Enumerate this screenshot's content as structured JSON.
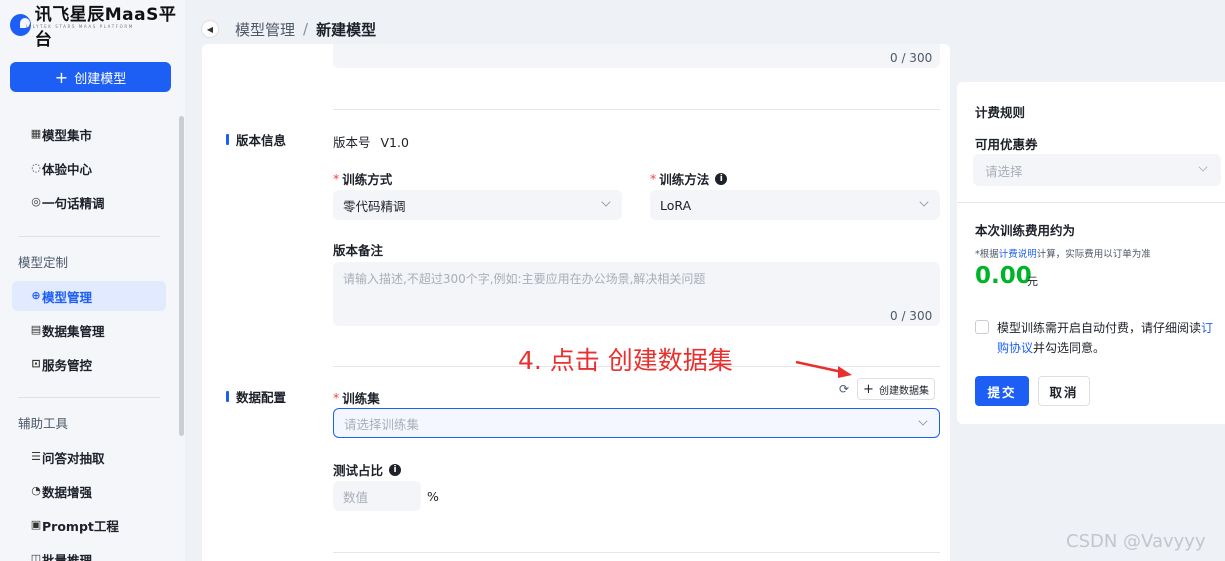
{
  "logo": {
    "text": "讯飞星辰MaaS平台",
    "sub": "IFLYTEK STARS MAAS PLATFORM"
  },
  "sidebar": {
    "create_label": "创建模型",
    "items": [
      {
        "label": "模型集市",
        "icon": "grid-icon"
      },
      {
        "label": "体验中心",
        "icon": "spinner-icon"
      },
      {
        "label": "一句话精调",
        "icon": "edit-icon"
      }
    ],
    "group_custom": "模型定制",
    "custom_items": [
      {
        "label": "模型管理",
        "icon": "model-icon",
        "active": true
      },
      {
        "label": "数据集管理",
        "icon": "dataset-icon"
      },
      {
        "label": "服务管控",
        "icon": "service-icon"
      }
    ],
    "group_tools": "辅助工具",
    "tool_items": [
      {
        "label": "问答对抽取",
        "icon": "list-icon"
      },
      {
        "label": "数据增强",
        "icon": "enhance-icon"
      },
      {
        "label": "Prompt工程",
        "icon": "prompt-icon"
      },
      {
        "label": "批量推理",
        "icon": "batch-icon"
      }
    ]
  },
  "breadcrumb": {
    "parent": "模型管理",
    "sep": "/",
    "current": "新建模型"
  },
  "form": {
    "top_counter": "0 / 300",
    "version_section": "版本信息",
    "version_label": "版本号",
    "version_value": "V1.0",
    "train_mode_label": "训练方式",
    "train_mode_value": "零代码精调",
    "train_method_label": "训练方法",
    "train_method_value": "LoRA",
    "remark_label": "版本备注",
    "remark_placeholder": "请输入描述,不超过300个字,例如:主要应用在办公场景,解决相关问题",
    "remark_counter": "0 / 300",
    "data_section": "数据配置",
    "train_set_label": "训练集",
    "train_set_placeholder": "请选择训练集",
    "create_dataset_label": "创建数据集",
    "test_ratio_label": "测试占比",
    "test_ratio_placeholder": "数值",
    "percent": "%"
  },
  "annotation": "4. 点击 创建数据集",
  "panel": {
    "title": "计费规则",
    "coupon_label": "可用优惠券",
    "coupon_placeholder": "请选择",
    "fee_title": "本次训练费用约为",
    "note_prefix": "*根据",
    "note_link": "计费说明",
    "note_suffix": "计算，实际费用以订单为准",
    "price": "0.00",
    "price_unit": "元",
    "agree_text": "模型训练需开启自动付费，请仔细阅读",
    "agree_link": "订购协议",
    "agree_suffix": "并勾选同意。",
    "submit": "提交",
    "cancel": "取消"
  },
  "watermark": "CSDN @Vavyyy",
  "colors": {
    "primary": "#1d5ff5",
    "price": "#00b42a",
    "annotation": "#e8312f"
  }
}
